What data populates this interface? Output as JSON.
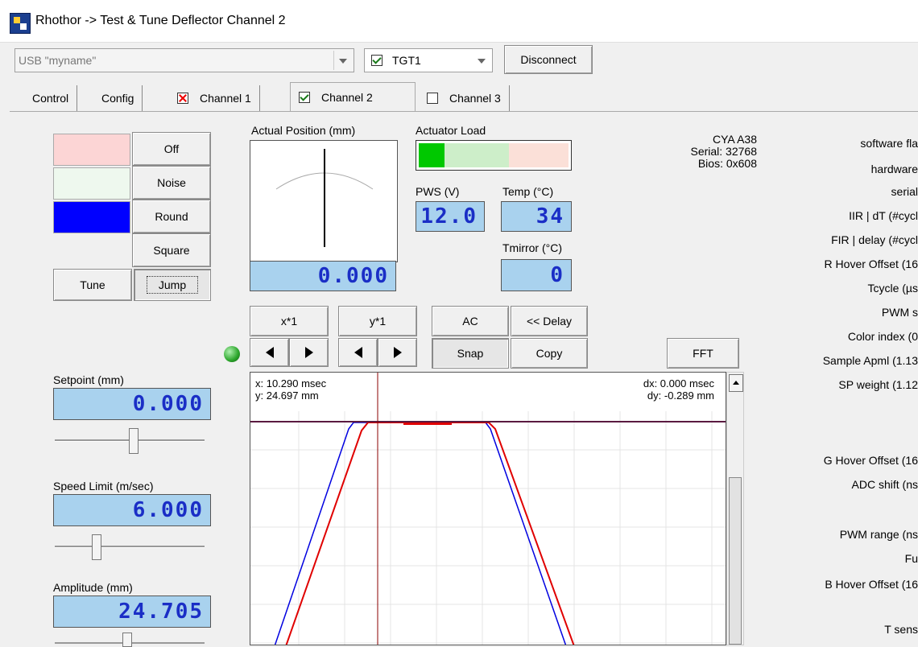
{
  "window": {
    "title": "Rhothor -> Test & Tune Deflector Channel 2"
  },
  "connection": {
    "device_combo_value": "USB \"myname\"",
    "target_checked": true,
    "target_value": "TGT1",
    "disconnect_label": "Disconnect"
  },
  "tabs": [
    {
      "label": "Control"
    },
    {
      "label": "Config"
    },
    {
      "label": "Channel 1",
      "state": "error"
    },
    {
      "label": "Channel 2",
      "state": "checked"
    },
    {
      "label": "Channel 3",
      "state": "unchecked"
    }
  ],
  "modes": {
    "off": "Off",
    "noise": "Noise",
    "round": "Round",
    "square": "Square",
    "tune": "Tune",
    "jump": "Jump"
  },
  "mode_colors": {
    "off": "#fcd5d5",
    "noise": "#eef8ee",
    "round": "#0000ff"
  },
  "position": {
    "label": "Actual Position (mm)",
    "value": "0.000"
  },
  "actuator": {
    "label": "Actuator Load",
    "colors": [
      "#00c800",
      "#cdeec9",
      "#fbe0d8"
    ]
  },
  "pws": {
    "label": "PWS (V)",
    "value": "12.0"
  },
  "temp": {
    "label": "Temp (°C)",
    "value": "34"
  },
  "tmirror": {
    "label": "Tmirror (°C)",
    "value": "0"
  },
  "device_info": {
    "model": "CYA A38",
    "serial": "Serial: 32768",
    "bios": "Bios: 0x608"
  },
  "scope_controls": {
    "x_scale": "x*1",
    "y_scale": "y*1",
    "ac": "AC",
    "delay": "<< Delay",
    "snap": "Snap",
    "copy": "Copy",
    "fft": "FFT",
    "led_color": "#2aa52a"
  },
  "setpoint": {
    "label": "Setpoint (mm)",
    "value": "0.000"
  },
  "speed": {
    "label": "Speed Limit (m/sec)",
    "value": "6.000"
  },
  "amplitude": {
    "label": "Amplitude (mm)",
    "value": "24.705"
  },
  "scope": {
    "cursor_x": "x: 10.290 msec",
    "cursor_y": "y: 24.697 mm",
    "dx": "dx: 0.000 msec",
    "dy": "dy: -0.289 mm",
    "colors": {
      "trace_red": "#e00000",
      "trace_blue": "#0000e0",
      "flat_line": "#5a1a40",
      "cursor": "#8b0000"
    }
  },
  "right_labels": [
    "software fla",
    "hardware",
    "serial",
    "IIR | dT (#cycl",
    "FIR | delay (#cycl",
    "R Hover Offset (16",
    "Tcycle (µs",
    "PWM s",
    "Color index (0",
    "Sample Apml (1.13",
    "SP weight (1.12",
    "G Hover Offset (16",
    "ADC shift (ns",
    "PWM range (ns",
    "Fu",
    "B Hover Offset (16",
    "T sens"
  ]
}
